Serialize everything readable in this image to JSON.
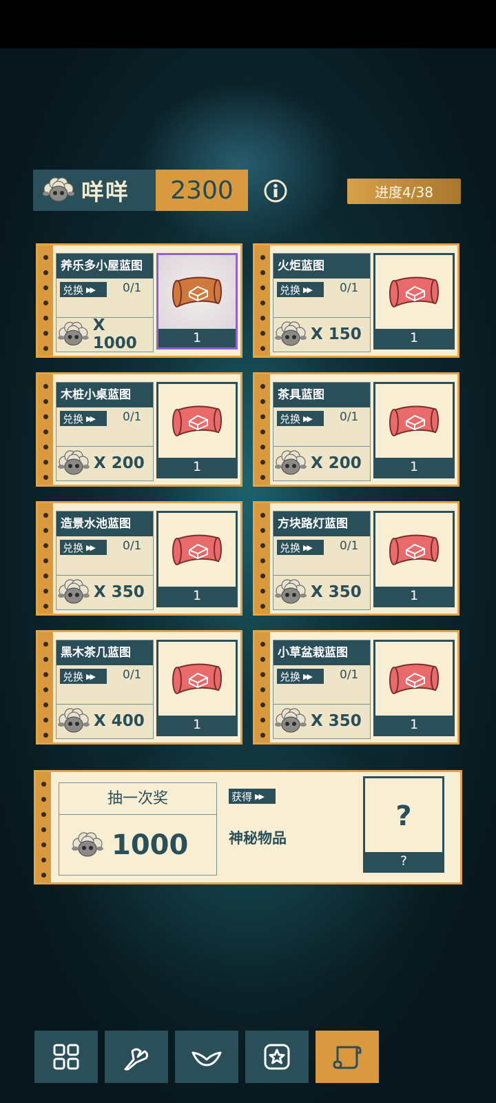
{
  "currency": {
    "name": "咩咩",
    "amount": "2300",
    "icon": "sheep-icon"
  },
  "progress": "进度4/38",
  "exchange_label": "兑换",
  "items": [
    {
      "title": "养乐多小屋蓝图",
      "count": "0/1",
      "price": "X 1000",
      "qty": "1",
      "selected": true,
      "scroll_color": "#cf7a3c"
    },
    {
      "title": "火炬蓝图",
      "count": "0/1",
      "price": "X 150",
      "qty": "1",
      "selected": false,
      "scroll_color": "#e86a6a"
    },
    {
      "title": "木桩小桌蓝图",
      "count": "0/1",
      "price": "X 200",
      "qty": "1",
      "selected": false,
      "scroll_color": "#e86a6a"
    },
    {
      "title": "茶具蓝图",
      "count": "0/1",
      "price": "X 200",
      "qty": "1",
      "selected": false,
      "scroll_color": "#e86a6a"
    },
    {
      "title": "造景水池蓝图",
      "count": "0/1",
      "price": "X 350",
      "qty": "1",
      "selected": false,
      "scroll_color": "#e86a6a"
    },
    {
      "title": "方块路灯蓝图",
      "count": "0/1",
      "price": "X 350",
      "qty": "1",
      "selected": false,
      "scroll_color": "#e86a6a"
    },
    {
      "title": "黑木茶几蓝图",
      "count": "0/1",
      "price": "X 400",
      "qty": "1",
      "selected": false,
      "scroll_color": "#e86a6a"
    },
    {
      "title": "小草盆栽蓝图",
      "count": "0/1",
      "price": "X 350",
      "qty": "1",
      "selected": false,
      "scroll_color": "#e86a6a"
    }
  ],
  "lottery": {
    "title": "抽一次奖",
    "price": "1000",
    "obtain_label": "获得",
    "reward_name": "神秘物品",
    "reward_symbol": "?",
    "reward_qty": "?"
  },
  "nav": [
    {
      "icon": "grid-icon",
      "active": false
    },
    {
      "icon": "branch-icon",
      "active": false
    },
    {
      "icon": "wings-icon",
      "active": false
    },
    {
      "icon": "star-icon",
      "active": false
    },
    {
      "icon": "scroll-map-icon",
      "active": true
    }
  ],
  "colors": {
    "teal": "#2a4f59",
    "gold": "#d9993f",
    "card": "#f7eed4",
    "selected_border": "#9061d6"
  }
}
